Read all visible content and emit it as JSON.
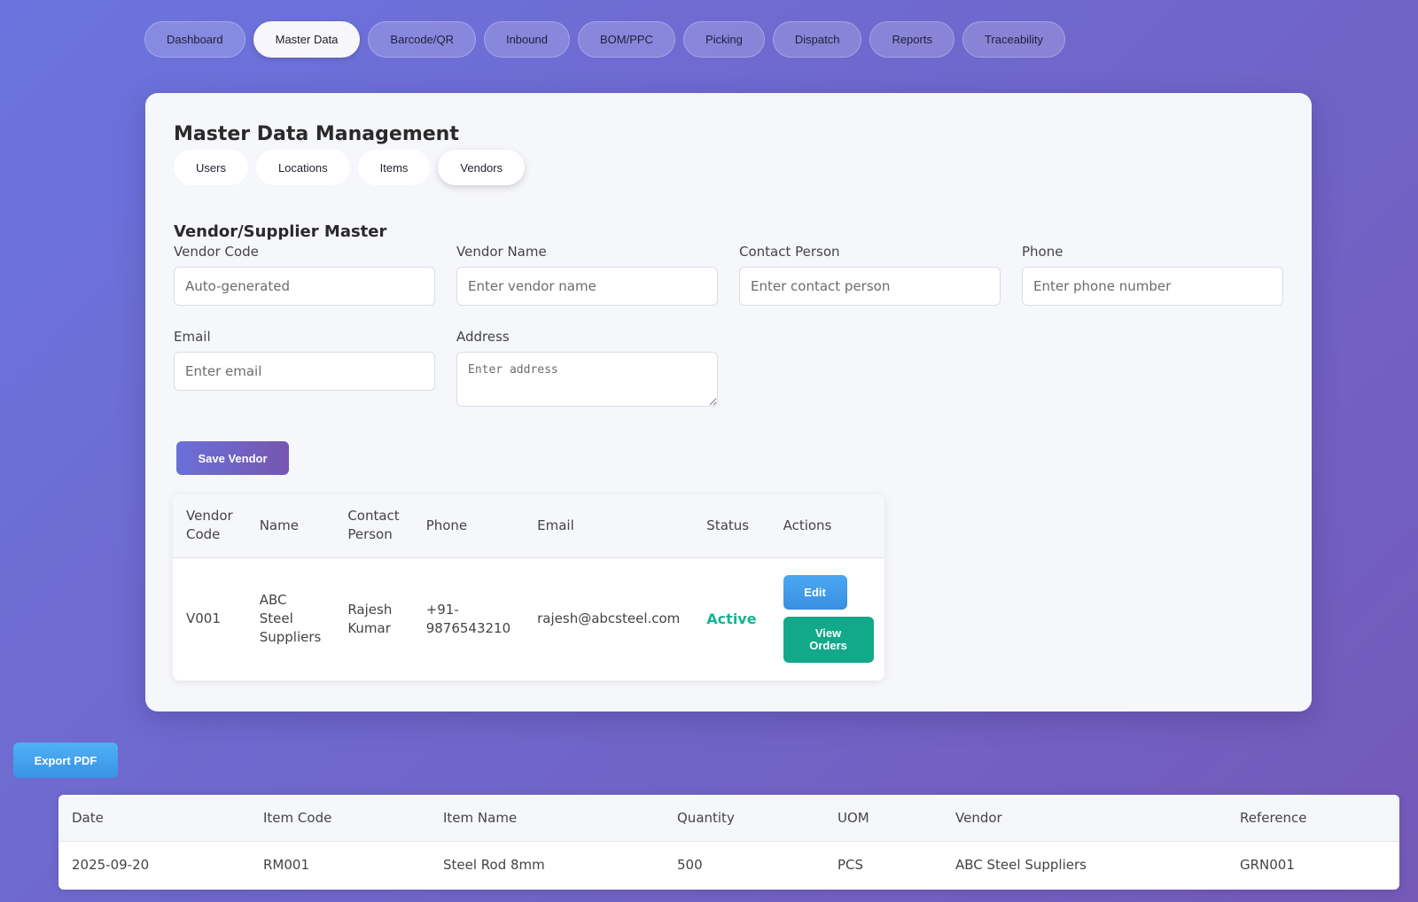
{
  "nav": {
    "items": [
      "Dashboard",
      "Master Data",
      "Barcode/QR",
      "Inbound",
      "BOM/PPC",
      "Picking",
      "Dispatch",
      "Reports",
      "Traceability"
    ],
    "active": "Master Data"
  },
  "card": {
    "title": "Master Data Management",
    "subtabs": [
      "Users",
      "Locations",
      "Items",
      "Vendors"
    ],
    "active_subtab": "Vendors"
  },
  "form": {
    "section_title": "Vendor/Supplier Master",
    "vendor_code": {
      "label": "Vendor Code",
      "placeholder": "Auto-generated",
      "value": ""
    },
    "vendor_name": {
      "label": "Vendor Name",
      "placeholder": "Enter vendor name",
      "value": ""
    },
    "contact_person": {
      "label": "Contact Person",
      "placeholder": "Enter contact person",
      "value": ""
    },
    "phone": {
      "label": "Phone",
      "placeholder": "Enter phone number",
      "value": ""
    },
    "email": {
      "label": "Email",
      "placeholder": "Enter email",
      "value": ""
    },
    "address": {
      "label": "Address",
      "placeholder": "Enter address",
      "value": ""
    },
    "save_label": "Save Vendor"
  },
  "vendor_table": {
    "columns": [
      "Vendor Code",
      "Name",
      "Contact Person",
      "Phone",
      "Email",
      "Status",
      "Actions"
    ],
    "rows": [
      {
        "code": "V001",
        "name": "ABC Steel Suppliers",
        "contact": "Rajesh Kumar",
        "phone": "+91-9876543210",
        "email": "rajesh@abcsteel.com",
        "status": "Active",
        "edit_label": "Edit",
        "view_label": "View Orders"
      }
    ]
  },
  "export_label": "Export PDF",
  "report_table": {
    "columns": [
      "Date",
      "Item Code",
      "Item Name",
      "Quantity",
      "UOM",
      "Vendor",
      "Reference"
    ],
    "rows": [
      [
        "2025-09-20",
        "RM001",
        "Steel Rod 8mm",
        "500",
        "PCS",
        "ABC Steel Suppliers",
        "GRN001"
      ]
    ]
  },
  "colors": {
    "background_start": "#6b74de",
    "background_end": "#7459b8",
    "status_active": "#16b493",
    "edit_button": "#3a8fe3",
    "view_button": "#11a98a"
  }
}
